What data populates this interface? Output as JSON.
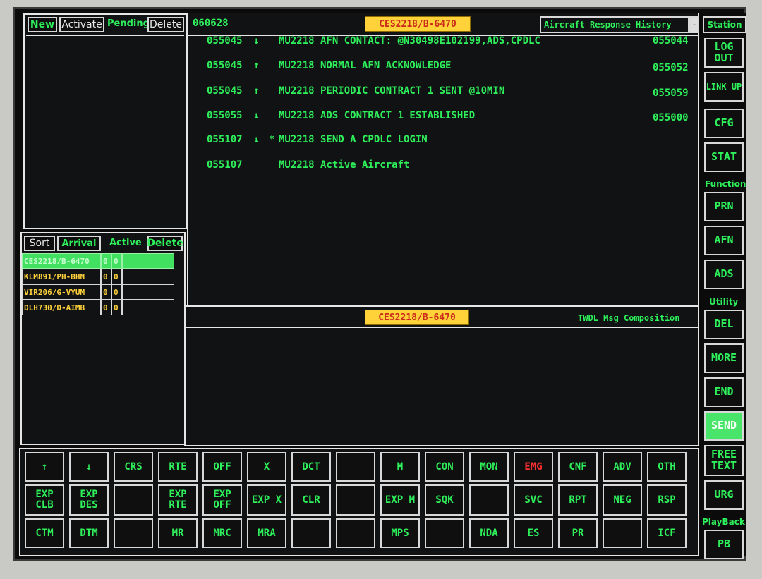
{
  "pending_toolbar": {
    "new": "New",
    "activate": "Activate",
    "pending": "Pending",
    "delete": "Delete"
  },
  "active_toolbar": {
    "sort": "Sort",
    "arrival": "Arrival",
    "dropdown": "-",
    "active": "Active",
    "delete": "Delete"
  },
  "aircraft_list": [
    {
      "callsign": "CES2218/B-6470",
      "c1": "0",
      "c2": "0"
    },
    {
      "callsign": "KLM891/PH-BHN",
      "c1": "0",
      "c2": "0"
    },
    {
      "callsign": "VIR206/G-VYUM",
      "c1": "0",
      "c2": "0"
    },
    {
      "callsign": "DLH730/D-AIMB",
      "c1": "0",
      "c2": "0"
    }
  ],
  "history": {
    "time": "060628",
    "callsign": "CES2218/B-6470",
    "title": "Aircraft Response History",
    "dropdown": "-",
    "rows": [
      {
        "time": "055045",
        "dir": "↓",
        "mark": "",
        "text": "MU2218 AFN CONTACT: @N30498E102199,ADS,CPDLC",
        "ref": "055044"
      },
      {
        "time": "055045",
        "dir": "↑",
        "mark": "",
        "text": "MU2218 NORMAL AFN ACKNOWLEDGE",
        "ref": "055052"
      },
      {
        "time": "055045",
        "dir": "↑",
        "mark": "",
        "text": "MU2218 PERIODIC CONTRACT 1 SENT @10MIN",
        "ref": "055059"
      },
      {
        "time": "055055",
        "dir": "↓",
        "mark": "",
        "text": "MU2218 ADS CONTRACT 1 ESTABLISHED",
        "ref": "055000"
      },
      {
        "time": "055107",
        "dir": "↓",
        "mark": "*",
        "text": "MU2218 SEND A CPDLC LOGIN",
        "ref": ""
      },
      {
        "time": "055107",
        "dir": "",
        "mark": "",
        "text": "MU2218 Active Aircraft",
        "ref": ""
      }
    ]
  },
  "composition": {
    "callsign": "CES2218/B-6470",
    "title": "TWDL Msg Composition"
  },
  "side": {
    "station_label": "Station",
    "log_out": "LOG OUT",
    "link_up": "LINK UP",
    "cfg": "CFG",
    "stat": "STAT",
    "function_label": "Function",
    "prn": "PRN",
    "afn": "AFN",
    "ads": "ADS",
    "utility_label": "Utility",
    "del": "DEL",
    "more": "MORE",
    "end": "END",
    "send": "SEND",
    "free_text": "FREE TEXT",
    "urg": "URG",
    "playback_label": "PlayBack",
    "pb": "PB"
  },
  "keys": {
    "r1": [
      "↑",
      "↓",
      "CRS",
      "RTE",
      "OFF",
      "X",
      "DCT",
      "",
      "M",
      "CON",
      "MON",
      "EMG",
      "CNF",
      "ADV",
      "OTH"
    ],
    "r2": [
      "EXP CLB",
      "EXP DES",
      "",
      "EXP RTE",
      "EXP OFF",
      "EXP X",
      "CLR",
      "",
      "EXP M",
      "SQK",
      "",
      "SVC",
      "RPT",
      "NEG",
      "RSP"
    ],
    "r3": [
      "CTM",
      "DTM",
      "",
      "MR",
      "MRC",
      "MRA",
      "",
      "",
      "MPS",
      "",
      "NDA",
      "ES",
      "PR",
      "",
      "ICF"
    ]
  },
  "colors": {
    "text_green": "#2ef05a",
    "send_bg": "#49e56a",
    "emg_red": "#ff3030",
    "callsign_bg": "#ffd23a"
  }
}
